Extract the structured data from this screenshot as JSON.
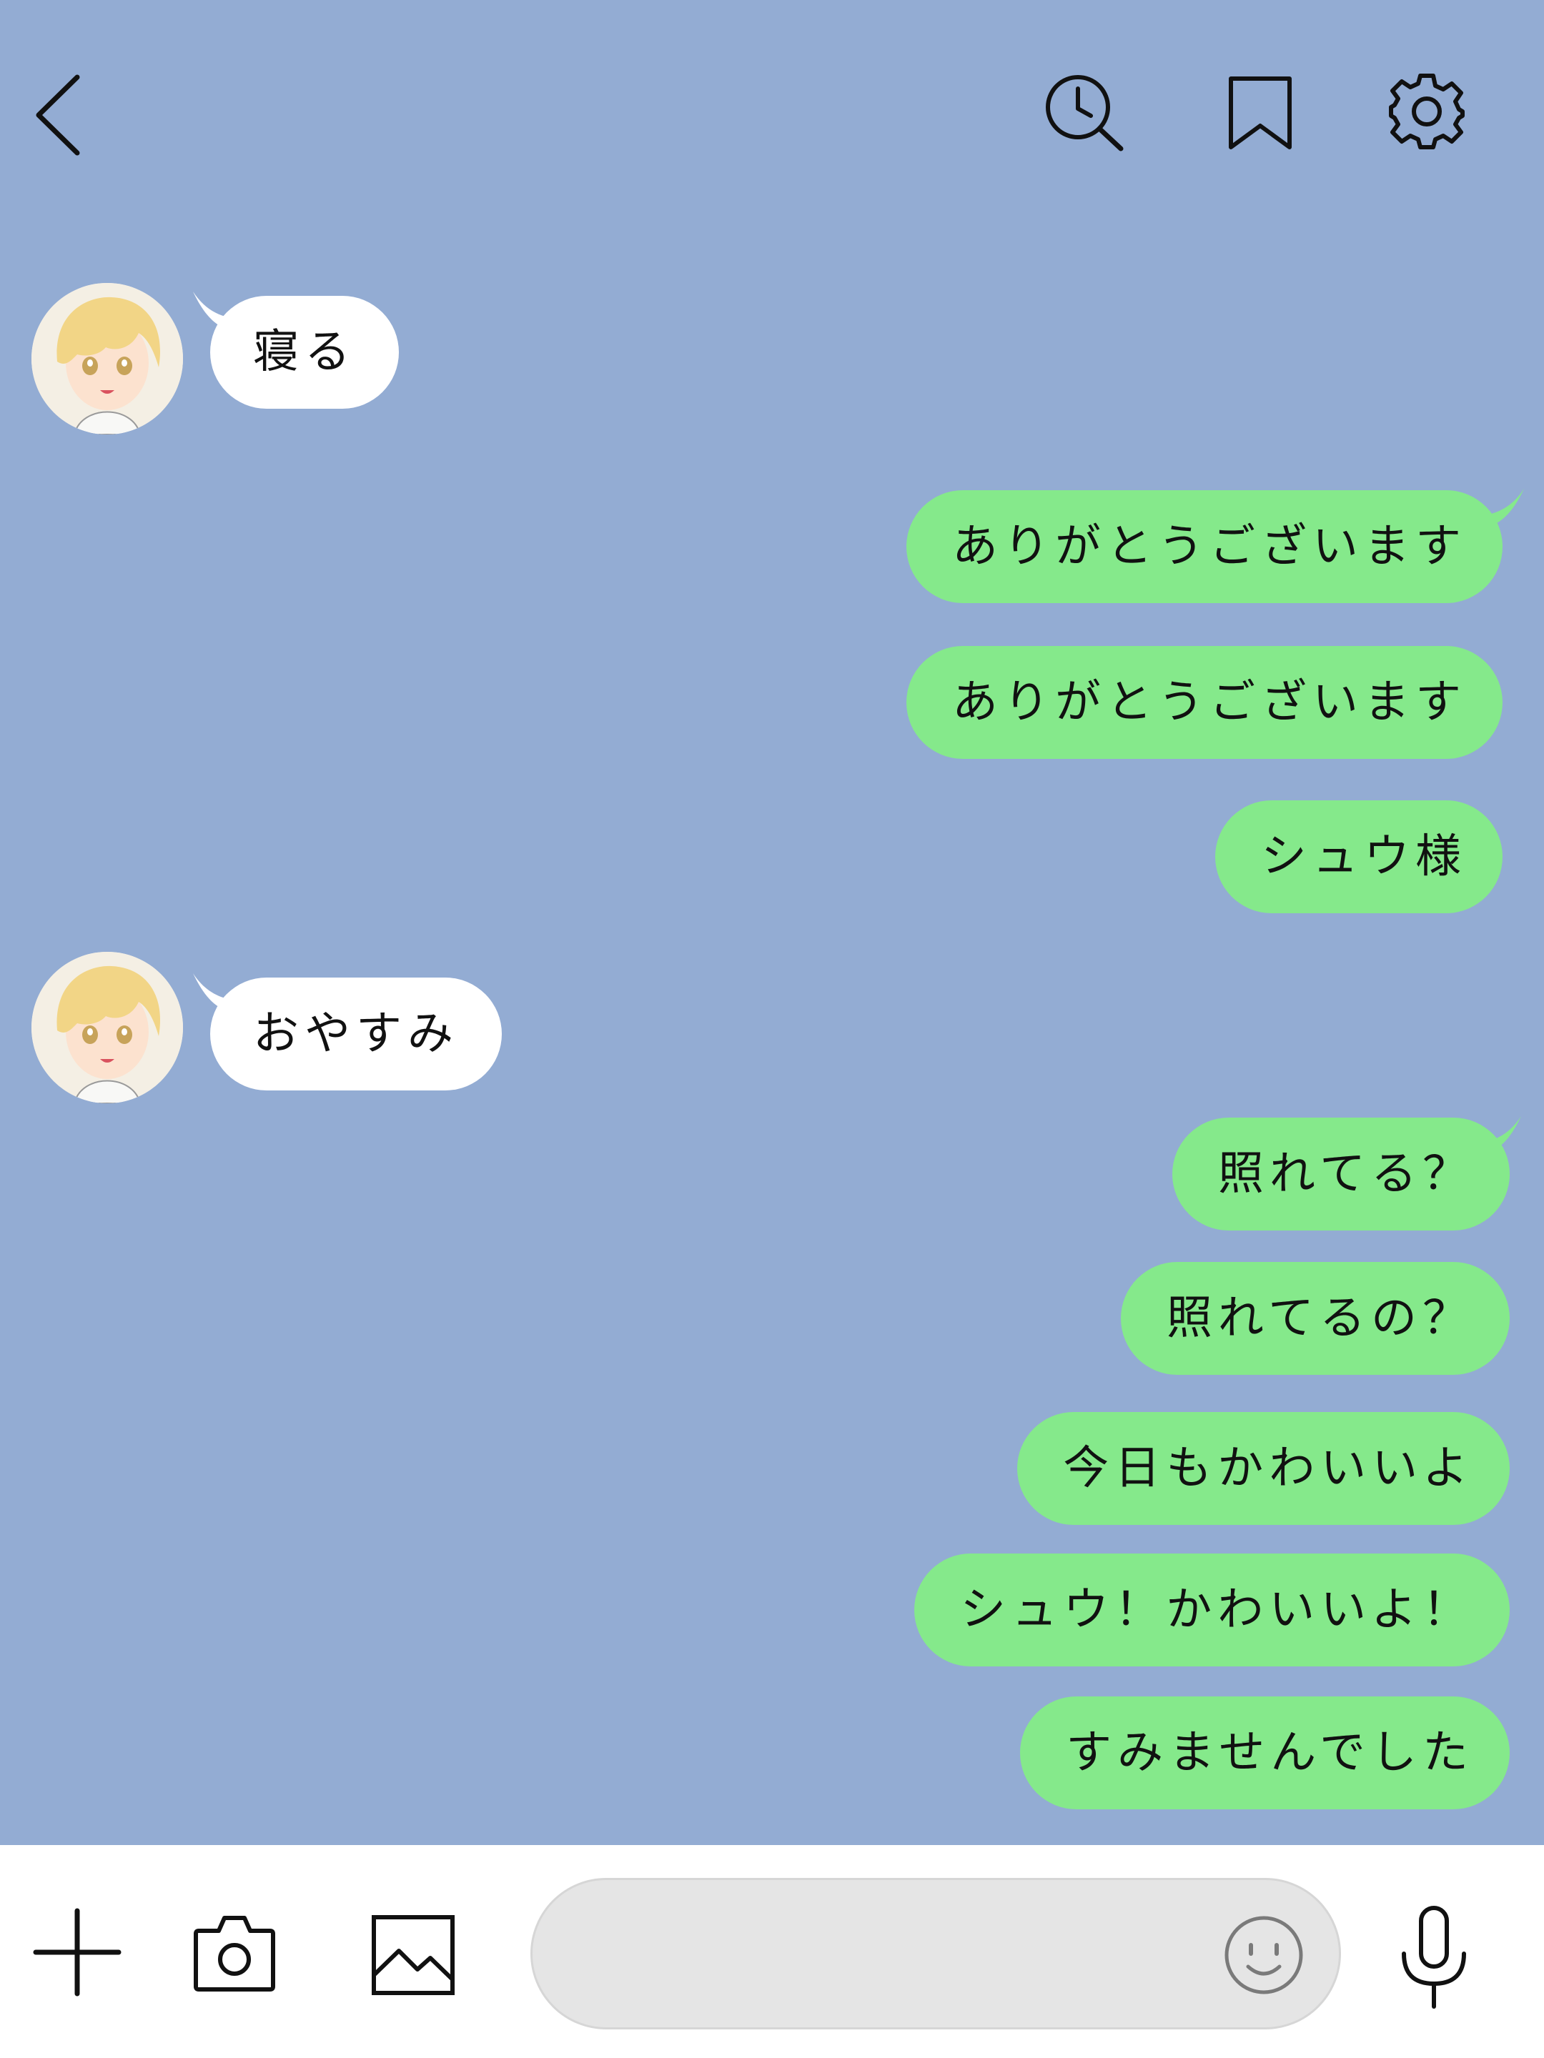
{
  "header": {
    "back_icon": "chevron-left-icon",
    "history_search_icon": "clock-search-icon",
    "bookmark_icon": "bookmark-icon",
    "settings_icon": "gear-icon"
  },
  "messages": [
    {
      "side": "in",
      "text": "寝る"
    },
    {
      "side": "out",
      "text": "ありがとうございます"
    },
    {
      "side": "out",
      "text": "ありがとうございます"
    },
    {
      "side": "out",
      "text": "シュウ様"
    },
    {
      "side": "in",
      "text": "おやすみ"
    },
    {
      "side": "out",
      "text": "照れてる？"
    },
    {
      "side": "out",
      "text": "照れてるの？"
    },
    {
      "side": "out",
      "text": "今日もかわいいよ"
    },
    {
      "side": "out",
      "text": "シュウ！かわいいよ！"
    },
    {
      "side": "out",
      "text": "すみませんでした"
    }
  ],
  "bottom_bar": {
    "plus_icon": "plus-icon",
    "camera_icon": "camera-icon",
    "image_icon": "image-icon",
    "input_placeholder": "",
    "emoji_icon": "smiley-icon",
    "mic_icon": "microphone-icon"
  },
  "colors": {
    "background": "#93acd3",
    "incoming_bubble": "#ffffff",
    "outgoing_bubble": "#85e98b",
    "bottom_bar": "#ffffff",
    "input_field": "#e5e5e5"
  }
}
